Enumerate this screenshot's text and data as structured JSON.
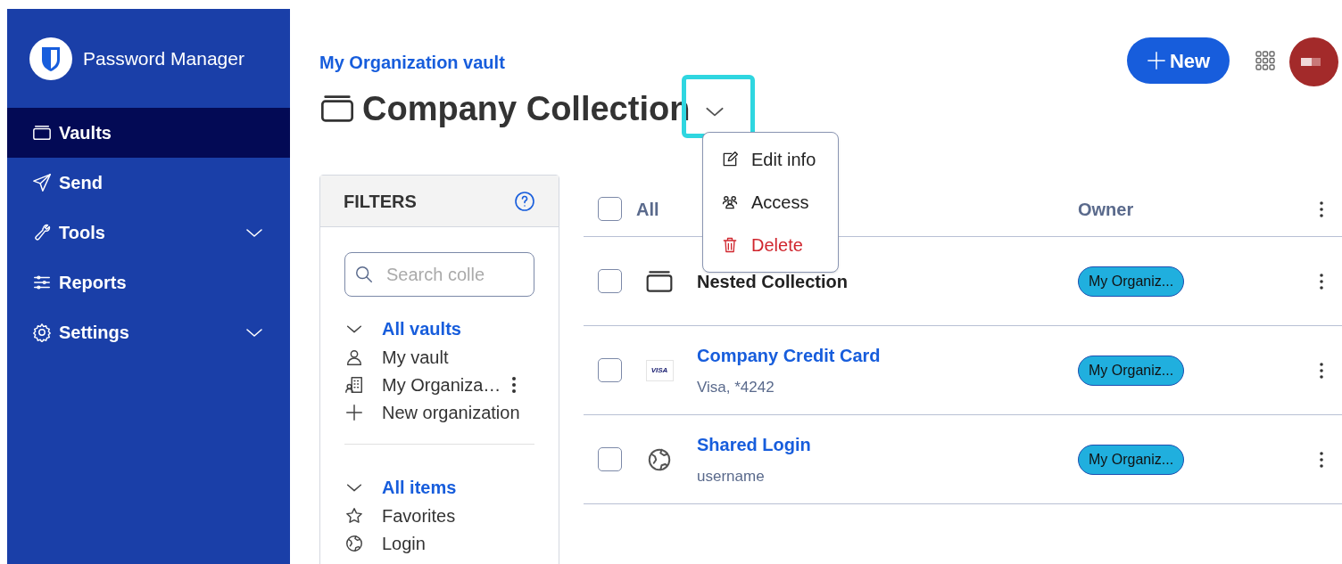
{
  "sidebar": {
    "product": "Password Manager",
    "items": [
      {
        "label": "Vaults",
        "selected": true
      },
      {
        "label": "Send",
        "selected": false
      },
      {
        "label": "Tools",
        "selected": false,
        "expandable": true
      },
      {
        "label": "Reports",
        "selected": false
      },
      {
        "label": "Settings",
        "selected": false,
        "expandable": true
      }
    ]
  },
  "header": {
    "breadcrumb": "My Organization vault",
    "title": "Company Collection",
    "new_button": "New"
  },
  "collection_menu": {
    "items": [
      {
        "label": "Edit info",
        "kind": "edit"
      },
      {
        "label": "Access",
        "kind": "access"
      },
      {
        "label": "Delete",
        "kind": "delete"
      }
    ]
  },
  "filters": {
    "title": "FILTERS",
    "search": {
      "placeholder": "Search colle"
    },
    "groups": [
      {
        "heading": "All vaults",
        "items": [
          {
            "label": "My vault"
          },
          {
            "label": "My Organiza…",
            "has_menu": true
          },
          {
            "label": "New organization"
          }
        ]
      },
      {
        "heading": "All items",
        "items": [
          {
            "label": "Favorites"
          },
          {
            "label": "Login"
          }
        ]
      }
    ]
  },
  "table": {
    "columns": [
      "All",
      "Owner"
    ],
    "select_all_checked": false,
    "rows": [
      {
        "kind": "collection",
        "name": "Nested Collection",
        "owner": "My Organiz...",
        "checked": false
      },
      {
        "kind": "card",
        "name": "Company Credit Card",
        "subtitle": "Visa, *4242",
        "brand": "VISA",
        "owner": "My Organiz...",
        "checked": false
      },
      {
        "kind": "login",
        "name": "Shared Login",
        "subtitle": "username",
        "owner": "My Organiz...",
        "checked": false
      }
    ]
  }
}
